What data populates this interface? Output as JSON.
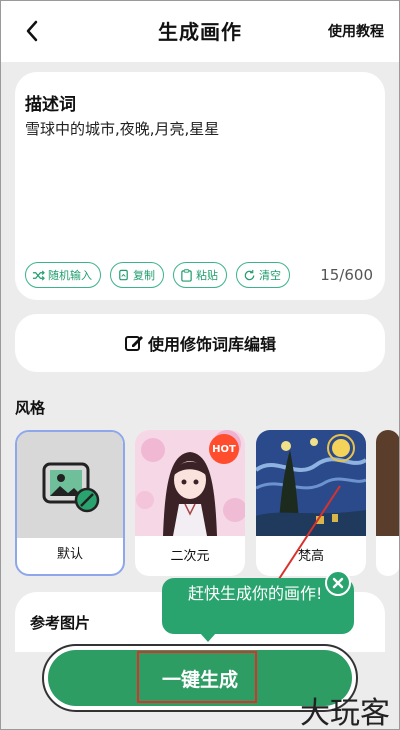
{
  "header": {
    "title": "生成画作",
    "tutorial": "使用教程"
  },
  "prompt": {
    "title": "描述词",
    "text": "雪球中的城市,夜晚,月亮,星星",
    "counter": "15/600",
    "chips": [
      {
        "label": "随机输入",
        "icon": "shuffle-icon"
      },
      {
        "label": "复制",
        "icon": "copy-icon"
      },
      {
        "label": "粘贴",
        "icon": "paste-icon"
      },
      {
        "label": "清空",
        "icon": "refresh-icon"
      }
    ]
  },
  "library_button": {
    "label": "使用修饰词库编辑",
    "icon": "edit-icon"
  },
  "style": {
    "label": "风格",
    "items": [
      {
        "label": "默认",
        "selected": true
      },
      {
        "label": "二次元",
        "badge": "HOT"
      },
      {
        "label": "梵高"
      }
    ]
  },
  "reference": {
    "label": "参考图片"
  },
  "tooltip": {
    "text": "赶快生成你的画作!"
  },
  "generate": {
    "label": "一键生成"
  },
  "watermark": "大玩客",
  "colors": {
    "accent": "#2e9d64",
    "chip": "#3cb38a",
    "annotation": "#d8322c"
  }
}
